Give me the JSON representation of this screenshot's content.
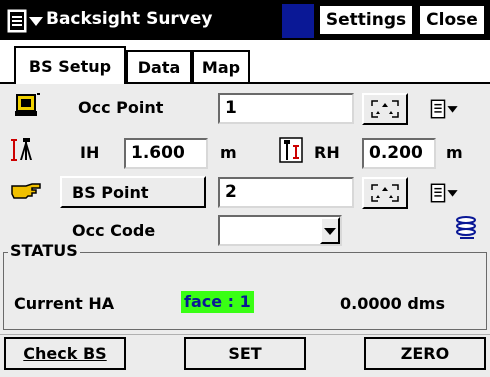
{
  "titlebar": {
    "title": "Backsight Survey",
    "settings_label": "Settings",
    "close_label": "Close"
  },
  "tabs": [
    {
      "label": "BS Setup",
      "active": true
    },
    {
      "label": "Data",
      "active": false
    },
    {
      "label": "Map",
      "active": false
    }
  ],
  "occ_point": {
    "label": "Occ Point",
    "value": "1"
  },
  "ih": {
    "label": "IH",
    "value": "1.600",
    "unit": "m"
  },
  "rh": {
    "label": "RH",
    "value": "0.200",
    "unit": "m"
  },
  "bs_point": {
    "label": "BS Point",
    "value": "2"
  },
  "occ_code": {
    "label": "Occ Code",
    "value": ""
  },
  "status": {
    "group_label": "STATUS",
    "current_ha_label": "Current HA",
    "face": "face : 1",
    "ha_value": "0.0000 dms"
  },
  "bottom": {
    "check_bs": "Check BS",
    "set": "SET",
    "zero": "ZERO"
  },
  "colors": {
    "title_bg": "#000000",
    "accent_blue": "#0a1896",
    "face_highlight": "#39ff14",
    "panel_bg": "#ececec"
  }
}
